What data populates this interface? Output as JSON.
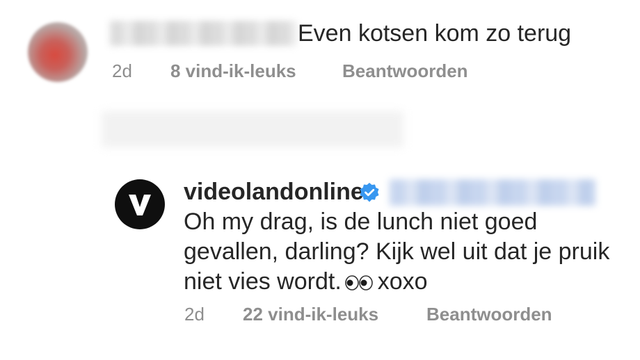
{
  "comment": {
    "text": "Even kotsen kom zo terug",
    "time": "2d",
    "likes": "8 vind-ik-leuks",
    "reply_label": "Beantwoorden"
  },
  "reply": {
    "username": "videolandonline",
    "verified": true,
    "avatar_letter": "V",
    "lines": [
      "Oh my drag, is de lunch niet goed",
      "gevallen, darling? Kijk wel uit dat je pruik",
      "niet vies wordt."
    ],
    "emoji_icon": "eyes-emoji",
    "tail": "xoxo",
    "time": "2d",
    "likes": "22 vind-ik-leuks",
    "reply_label": "Beantwoorden"
  },
  "colors": {
    "text": "#262626",
    "meta": "#8e8e8e",
    "verified": "#3897f0"
  }
}
